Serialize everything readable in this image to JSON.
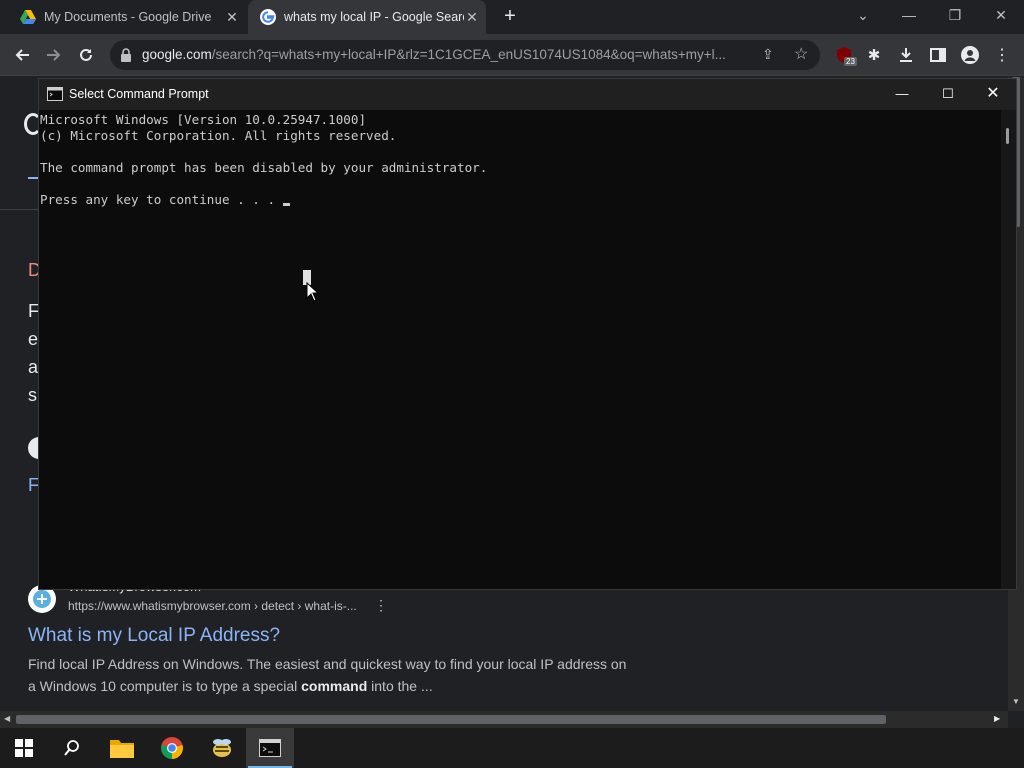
{
  "browser": {
    "tabs": [
      {
        "title": "My Documents - Google Drive",
        "icon": "google-drive-icon"
      },
      {
        "title": "whats my local IP - Google Search",
        "icon": "google-icon"
      }
    ],
    "url_host": "google.com",
    "url_rest": "/search?q=whats+my+local+IP&rlz=1C1GCEA_enUS1074US1084&oq=whats+my+l...",
    "extension_badge": "23"
  },
  "page": {
    "partial_letters": [
      "D",
      "F",
      "e",
      "a",
      "s",
      "F"
    ],
    "result": {
      "site_name": "WhatIsMyBrowser.com",
      "url": "https://www.whatismybrowser.com › detect › what-is-...",
      "title": "What is my Local IP Address?",
      "snippet_before": "Find local IP Address on Windows. The easiest and quickest way to find your local IP address on a Windows 10 computer is to type a special ",
      "snippet_bold": "command",
      "snippet_after": " into the ..."
    }
  },
  "cmd": {
    "title": "Select Command Prompt",
    "lines": [
      "Microsoft Windows [Version 10.0.25947.1000]",
      "(c) Microsoft Corporation. All rights reserved.",
      "",
      "The command prompt has been disabled by your administrator.",
      "",
      "Press any key to continue . . . "
    ]
  },
  "colors": {
    "link": "#8ab4f8",
    "console_text": "#cccccc",
    "taskbar_accent": "#76b9ed"
  }
}
